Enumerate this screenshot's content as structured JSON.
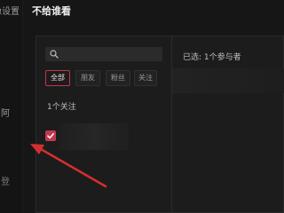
{
  "sidebar": {
    "top_label": "隐设置",
    "items": [
      "",
      "",
      "",
      "",
      "",
      "",
      ""
    ],
    "partial_labels": [
      "",
      "",
      "",
      "",
      "",
      "",
      ""
    ]
  },
  "dialog": {
    "title": "不给谁看"
  },
  "left_pane": {
    "search": {
      "value": "",
      "placeholder": ""
    },
    "tabs": [
      {
        "label": "全部",
        "active": true
      },
      {
        "label": "朋友",
        "active": false
      },
      {
        "label": "粉丝",
        "active": false
      },
      {
        "label": "关注",
        "active": false
      }
    ],
    "count_label": "1个关注",
    "items": [
      {
        "checked": true
      }
    ]
  },
  "right_pane": {
    "selected_label": "已选: 1个参与者"
  },
  "colors": {
    "accent": "#c2384e",
    "arrow": "#d32f2f",
    "background": "#161616"
  },
  "side_labels": {
    "s1": "",
    "s2": "",
    "s3": "阿",
    "s4": "",
    "s5": "",
    "s6": "登"
  }
}
